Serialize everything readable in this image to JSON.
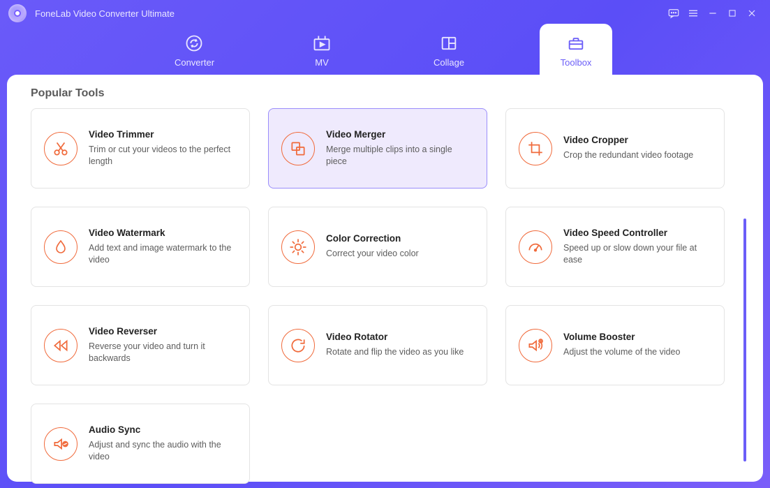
{
  "app": {
    "title": "FoneLab Video Converter Ultimate"
  },
  "tabs": [
    {
      "id": "converter",
      "label": "Converter"
    },
    {
      "id": "mv",
      "label": "MV"
    },
    {
      "id": "collage",
      "label": "Collage"
    },
    {
      "id": "toolbox",
      "label": "Toolbox",
      "active": true
    }
  ],
  "section": {
    "title": "Popular Tools"
  },
  "tools": [
    {
      "id": "trimmer",
      "title": "Video Trimmer",
      "desc": "Trim or cut your videos to the perfect length"
    },
    {
      "id": "merger",
      "title": "Video Merger",
      "desc": "Merge multiple clips into a single piece",
      "active": true
    },
    {
      "id": "cropper",
      "title": "Video Cropper",
      "desc": "Crop the redundant video footage"
    },
    {
      "id": "watermark",
      "title": "Video Watermark",
      "desc": "Add text and image watermark to the video"
    },
    {
      "id": "color",
      "title": "Color Correction",
      "desc": "Correct your video color"
    },
    {
      "id": "speed",
      "title": "Video Speed Controller",
      "desc": "Speed up or slow down your file at ease"
    },
    {
      "id": "reverser",
      "title": "Video Reverser",
      "desc": "Reverse your video and turn it backwards"
    },
    {
      "id": "rotator",
      "title": "Video Rotator",
      "desc": "Rotate and flip the video as you like"
    },
    {
      "id": "volume",
      "title": "Volume Booster",
      "desc": "Adjust the volume of the video"
    },
    {
      "id": "sync",
      "title": "Audio Sync",
      "desc": "Adjust and sync the audio with the video"
    }
  ],
  "colors": {
    "accent": "#6b5ef8",
    "tool_icon": "#f06a3b",
    "card_active_bg": "#efeafd"
  }
}
